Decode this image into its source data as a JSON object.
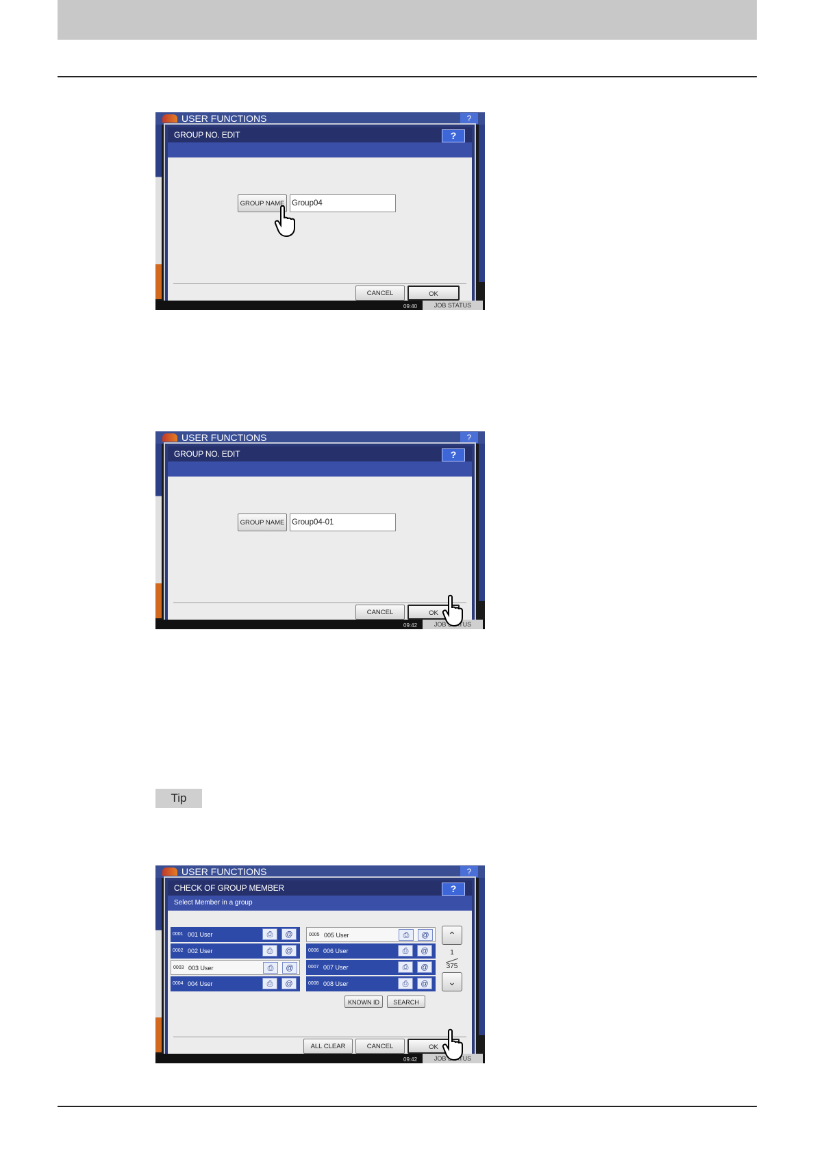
{
  "screens": [
    {
      "window_title": "USER FUNCTIONS",
      "help": "?",
      "dialog_title": "GROUP NO. EDIT",
      "group_name_button": "GROUP NAME",
      "group_name_value": "Group04",
      "cancel": "CANCEL",
      "ok": "OK",
      "clock": "09:40",
      "job_status": "JOB STATUS"
    },
    {
      "window_title": "USER FUNCTIONS",
      "help": "?",
      "dialog_title": "GROUP NO. EDIT",
      "group_name_button": "GROUP NAME",
      "group_name_value": "Group04-01",
      "cancel": "CANCEL",
      "ok": "OK",
      "clock": "09:42",
      "job_status": "JOB STATUS"
    },
    {
      "window_title": "USER FUNCTIONS",
      "help": "?",
      "dialog_title": "CHECK OF GROUP MEMBER",
      "subtitle": "Select Member in a group",
      "members": [
        {
          "id": "0001",
          "name": "001 User",
          "selected": true
        },
        {
          "id": "0002",
          "name": "002 User",
          "selected": true
        },
        {
          "id": "0003",
          "name": "003 User",
          "selected": false
        },
        {
          "id": "0004",
          "name": "004 User",
          "selected": true
        },
        {
          "id": "0005",
          "name": "005 User",
          "selected": false
        },
        {
          "id": "0006",
          "name": "006 User",
          "selected": true
        },
        {
          "id": "0007",
          "name": "007 User",
          "selected": true
        },
        {
          "id": "0008",
          "name": "008 User",
          "selected": true
        }
      ],
      "page_current": "1",
      "page_total": "375",
      "known_id": "KNOWN ID",
      "search": "SEARCH",
      "all_clear": "ALL CLEAR",
      "cancel": "CANCEL",
      "ok": "OK",
      "clock": "09:42",
      "job_status": "JOB STATUS"
    }
  ],
  "tip_label": "Tip",
  "icons": {
    "fax": "fax-icon",
    "mail": "email-icon",
    "up": "chevron-up-icon",
    "down": "chevron-down-icon",
    "hand": "pointing-hand-icon"
  },
  "colors": {
    "header_bar": "#c8c8c8",
    "dialog_header": "#26306a",
    "selected_member": "#2e4aa8"
  }
}
